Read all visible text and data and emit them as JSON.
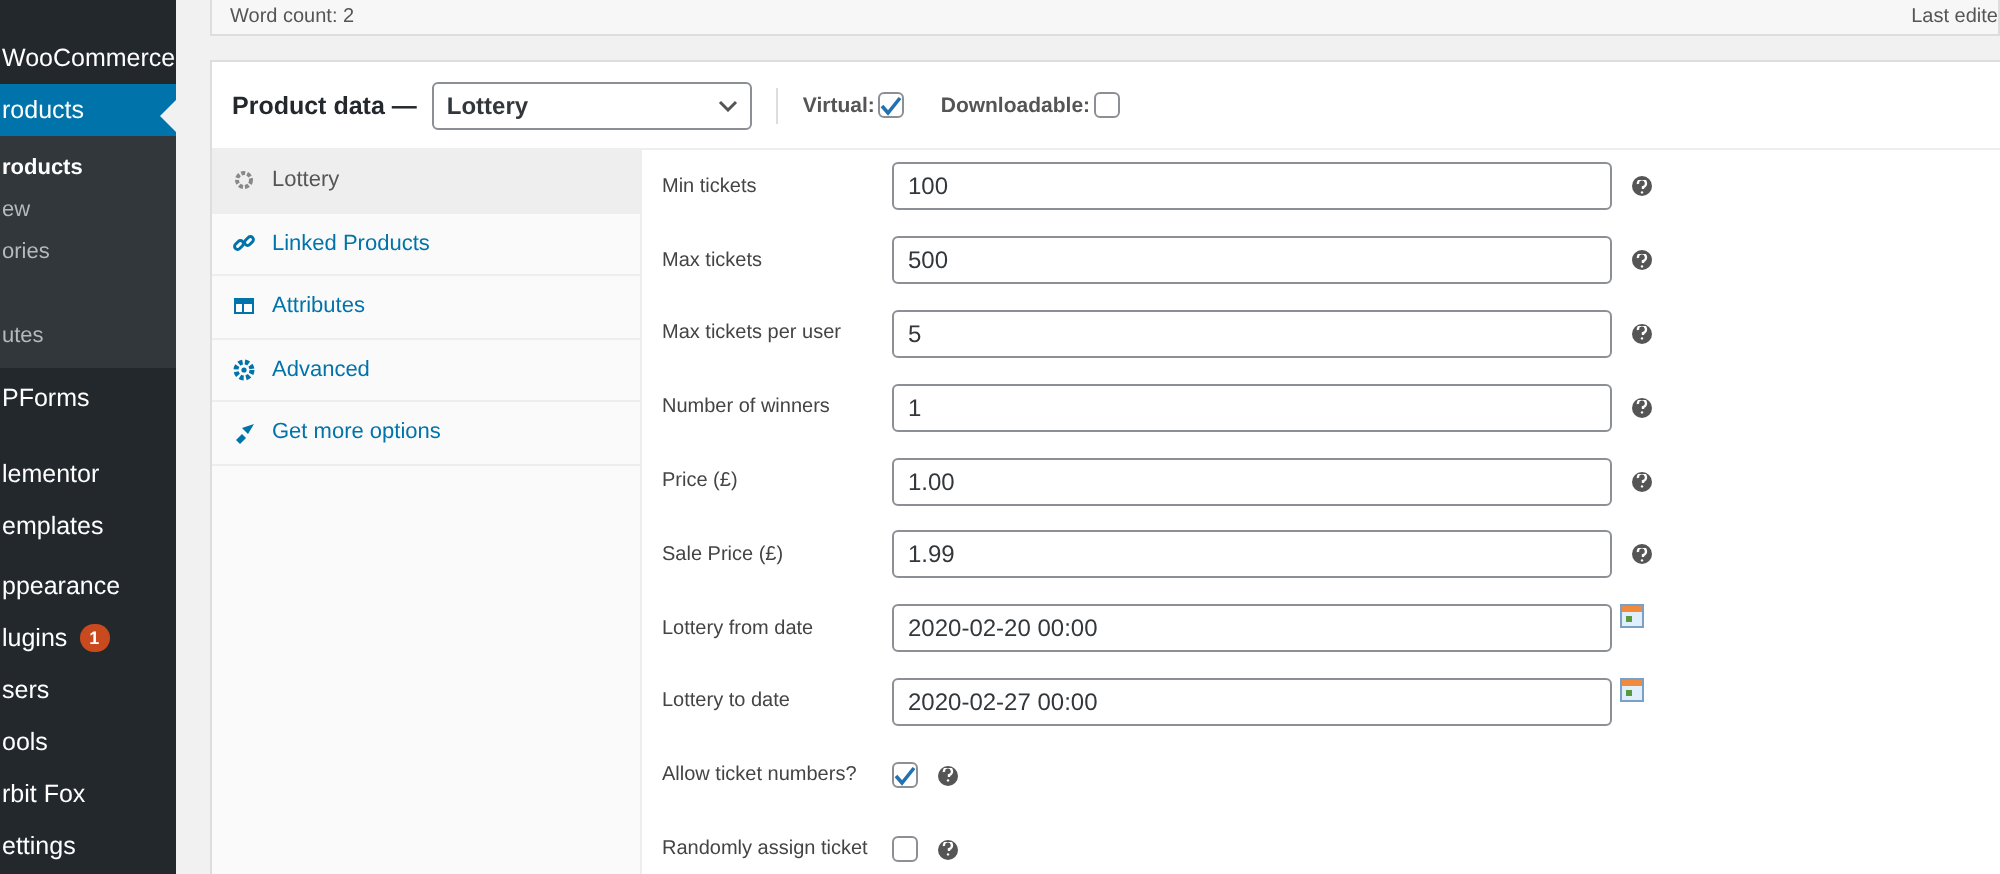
{
  "sidebar": {
    "items": [
      {
        "label": "WooCommerce",
        "selected": false
      },
      {
        "label": "roducts",
        "selected": true
      },
      {
        "label": "roducts",
        "kind": "sub",
        "selected": true
      },
      {
        "label": "ew",
        "kind": "sub",
        "selected": false
      },
      {
        "label": "ories",
        "kind": "sub",
        "selected": false
      },
      {
        "label": "utes",
        "kind": "sub",
        "selected": false
      },
      {
        "label": "PForms",
        "selected": false
      },
      {
        "label": "lementor",
        "selected": false
      },
      {
        "label": "emplates",
        "selected": false
      },
      {
        "label": "ppearance",
        "selected": false
      },
      {
        "label": "lugins",
        "badge": "1",
        "selected": false
      },
      {
        "label": "sers",
        "selected": false
      },
      {
        "label": "ools",
        "selected": false
      },
      {
        "label": "rbit Fox",
        "selected": false
      },
      {
        "label": "ettings",
        "selected": false
      }
    ]
  },
  "editor_status": {
    "word_count": "Word count: 2",
    "last_edited": "Last edite"
  },
  "product_data": {
    "title": "Product data —",
    "type": "Lottery",
    "virtual": {
      "label": "Virtual:",
      "checked": true
    },
    "downloadable": {
      "label": "Downloadable:",
      "checked": false
    }
  },
  "tabs": [
    {
      "label": "Lottery",
      "selected": true
    },
    {
      "label": "Linked Products",
      "selected": false
    },
    {
      "label": "Attributes",
      "selected": false
    },
    {
      "label": "Advanced",
      "selected": false
    },
    {
      "label": "Get more options",
      "selected": false
    }
  ],
  "fields": [
    {
      "kind": "text",
      "label": "Min tickets",
      "value": "100"
    },
    {
      "kind": "text",
      "label": "Max tickets",
      "value": "500"
    },
    {
      "kind": "text",
      "label": "Max tickets per user",
      "value": "5"
    },
    {
      "kind": "text",
      "label": "Number of winners",
      "value": "1"
    },
    {
      "kind": "text",
      "label": "Price (£)",
      "value": "1.00"
    },
    {
      "kind": "text",
      "label": "Sale Price (£)",
      "value": "1.99"
    },
    {
      "kind": "date",
      "label": "Lottery from date",
      "value": "2020-02-20 00:00"
    },
    {
      "kind": "date",
      "label": "Lottery to date",
      "value": "2020-02-27 00:00"
    },
    {
      "kind": "checkbox",
      "label": "Allow ticket numbers?",
      "checked": true
    },
    {
      "kind": "checkbox",
      "label": "Randomly assign ticket",
      "checked": false
    }
  ]
}
